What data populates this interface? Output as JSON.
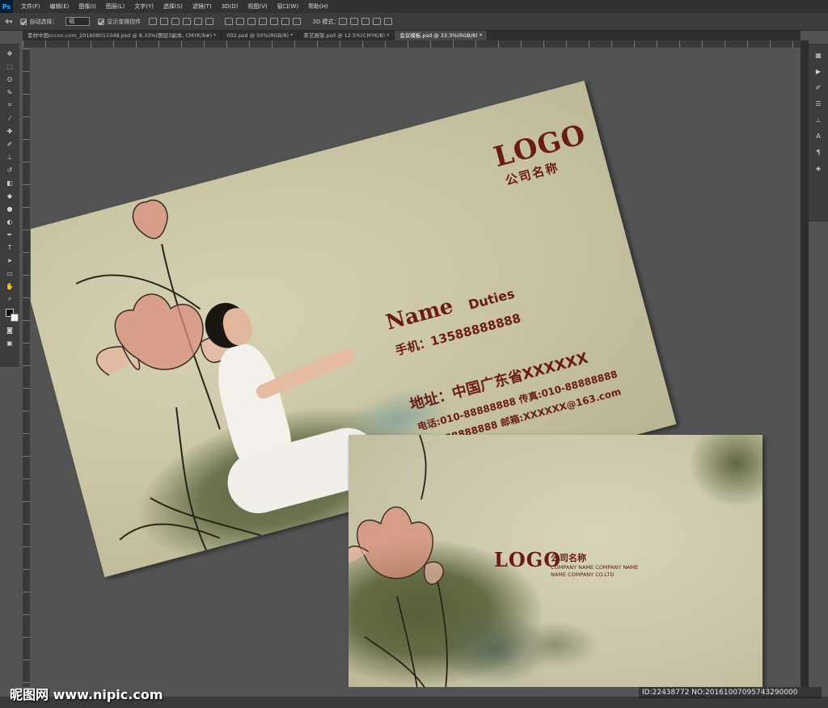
{
  "app": {
    "logo": "Ps"
  },
  "menu": [
    "文件(F)",
    "编辑(E)",
    "图像(I)",
    "图层(L)",
    "文字(Y)",
    "选择(S)",
    "滤镜(T)",
    "3D(D)",
    "视图(V)",
    "窗口(W)",
    "帮助(H)"
  ],
  "options": {
    "auto_select_label": "自动选择：",
    "auto_select_value": "组",
    "show_transform_label": "显示变换控件",
    "mode_3d_label": "3D 模式："
  },
  "tabs": [
    {
      "label": "素材中国sccnn.com_201608011048.psd @ 8.33%(图层3副本, CMYK/8#) *",
      "active": false
    },
    {
      "label": "002.psd @ 50%(RGB/8) *",
      "active": false
    },
    {
      "label": "茶艺展架.psd @ 12.5%(CMYK/8) *",
      "active": false
    },
    {
      "label": "会议模板.psd @ 33.3%(RGB/8) *",
      "active": true
    }
  ],
  "tools": [
    "move-icon",
    "marquee-icon",
    "lasso-icon",
    "quick-select-icon",
    "crop-icon",
    "eyedropper-icon",
    "healing-icon",
    "brush-icon",
    "stamp-icon",
    "history-brush-icon",
    "eraser-icon",
    "paint-bucket-icon",
    "blur-icon",
    "dodge-icon",
    "pen-icon",
    "type-icon",
    "path-select-icon",
    "shape-icon",
    "hand-icon",
    "zoom-icon"
  ],
  "card_front": {
    "logo": "LOGO",
    "company": "公司名称",
    "name": "Name",
    "duties": "Duties",
    "mobile": "手机：13588888888",
    "address": "地址：中国广东省XXXXXX",
    "phone_fax": "电话:010-88888888  传真:010-88888888",
    "qq_email": "Q Q:88888888  邮箱:XXXXXX@163.com"
  },
  "card_back": {
    "logo": "LOGO",
    "company": "公司名称",
    "company_en_1": "COMPANY NAME COMPANY NAME",
    "company_en_2": "NAME COMPANY CO.LTD"
  },
  "watermark": {
    "site": "昵图网 www.nipic.com",
    "id": "ID:22438772 NO:20161007095743290000"
  },
  "colors": {
    "accent_text": "#6b1a18",
    "paper": "#cbc7a8",
    "ink_green": "#57603a",
    "lotus_pink": "#d9907e"
  }
}
